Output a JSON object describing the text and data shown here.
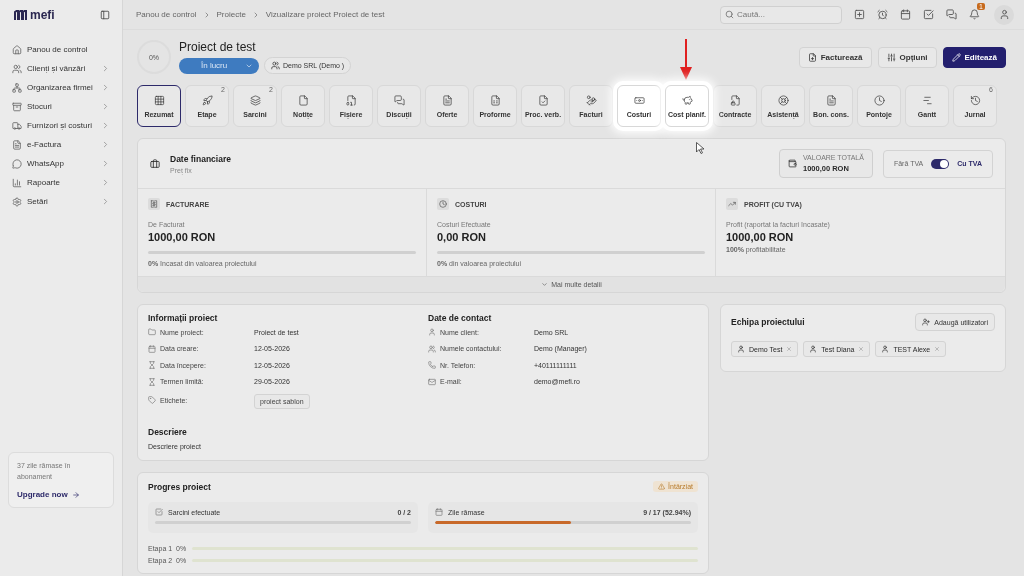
{
  "sidebar": {
    "logo": "mefi",
    "items": [
      {
        "label": "Panou de control",
        "has_children": false
      },
      {
        "label": "Clienți și vânzări",
        "has_children": true
      },
      {
        "label": "Organizarea firmei",
        "has_children": true
      },
      {
        "label": "Stocuri",
        "has_children": true
      },
      {
        "label": "Furnizori și costuri",
        "has_children": true
      },
      {
        "label": "e-Factura",
        "has_children": true
      },
      {
        "label": "WhatsApp",
        "has_children": true
      },
      {
        "label": "Rapoarte",
        "has_children": true
      },
      {
        "label": "Setări",
        "has_children": true
      }
    ],
    "upgrade": {
      "text": "37 zile rămase în abonament",
      "link": "Upgrade now"
    }
  },
  "header": {
    "breadcrumb": [
      "Panou de control",
      "Proiecte",
      "Vizualizare proiect Proiect de test"
    ],
    "search": {
      "placeholder": "Caută..."
    },
    "notification_count": "1"
  },
  "project": {
    "progress": "0%",
    "title": "Proiect de test",
    "status": "În lucru",
    "client": "Demo SRL (Demo )",
    "actions": [
      {
        "label": "Facturează",
        "kind": "outline"
      },
      {
        "label": "Opțiuni",
        "kind": "outline"
      },
      {
        "label": "Editează",
        "kind": "primary"
      }
    ]
  },
  "tabs": [
    {
      "label": "Rezumat",
      "selected": true,
      "highlighted": false
    },
    {
      "label": "Etape",
      "badge": "2",
      "selected": false,
      "highlighted": false
    },
    {
      "label": "Sarcini",
      "badge": "2",
      "selected": false,
      "highlighted": false
    },
    {
      "label": "Notițe",
      "selected": false,
      "highlighted": false
    },
    {
      "label": "Fișiere",
      "selected": false,
      "highlighted": false
    },
    {
      "label": "Discuții",
      "selected": false,
      "highlighted": false
    },
    {
      "label": "Oferte",
      "selected": false,
      "highlighted": false
    },
    {
      "label": "Proforme",
      "selected": false,
      "highlighted": false
    },
    {
      "label": "Proc. verb.",
      "selected": false,
      "highlighted": false
    },
    {
      "label": "Facturi",
      "selected": false,
      "highlighted": false
    },
    {
      "label": "Costuri",
      "selected": false,
      "highlighted": true
    },
    {
      "label": "Cost planif.",
      "selected": false,
      "highlighted": true
    },
    {
      "label": "Contracte",
      "selected": false,
      "highlighted": false
    },
    {
      "label": "Asistență",
      "selected": false,
      "highlighted": false
    },
    {
      "label": "Bon. cons.",
      "selected": false,
      "highlighted": false
    },
    {
      "label": "Pontoje",
      "selected": false,
      "highlighted": false
    },
    {
      "label": "Gantt",
      "selected": false,
      "highlighted": false
    },
    {
      "label": "Jurnal",
      "badge": "6",
      "selected": false,
      "highlighted": false
    }
  ],
  "financial": {
    "title": "Date financiare",
    "subtitle": "Preț fix",
    "total_label": "VALOARE TOTALĂ",
    "total": "1000,00 RON",
    "vat_off_label": "Fără TVA",
    "vat_on": true,
    "vat_on_label": "Cu TVA",
    "columns": [
      {
        "title": "FACTURARE",
        "label": "De Facturat",
        "value": "1000,00 RON",
        "has_bar": true,
        "level": 0,
        "note": "**0%** încasat din valoarea proiectului"
      },
      {
        "title": "COSTURI",
        "label": "Costuri Efectuate",
        "value": "0,00 RON",
        "has_bar": true,
        "level": 0,
        "note": "**0%** din valoarea proiectului"
      },
      {
        "title": "PROFIT (CU TVA)",
        "label": "Profit (raportat la facturi încasate)",
        "value": "1000,00 RON",
        "has_bar": false,
        "note": "**100%** profitabilitate"
      }
    ],
    "more": "Mai multe detalii"
  },
  "info": {
    "title": "Informații proiect",
    "rows": [
      {
        "label": "Nume proiect:",
        "value": "Proiect de test"
      },
      {
        "label": "Data creare:",
        "value": "12-05-2026"
      },
      {
        "label": "Data începere:",
        "value": "12-05-2026"
      },
      {
        "label": "Termen limită:",
        "value": "29-05-2026"
      },
      {
        "label": "Etichete:",
        "value": "proiect sablon",
        "kind": "tag"
      }
    ],
    "contact_title": "Date de contact",
    "contact_rows": [
      {
        "label": "Nume client:",
        "value": "Demo SRL"
      },
      {
        "label": "Numele contactului:",
        "value": "Demo (Manager)"
      },
      {
        "label": "Nr. Telefon:",
        "value": "+40111111111"
      },
      {
        "label": "E-mail:",
        "value": "demo@mefi.ro"
      }
    ],
    "description_title": "Descriere",
    "description": "Descriere proiect"
  },
  "team": {
    "title": "Echipa proiectului",
    "add": "Adaugă utilizatori",
    "members": [
      "Demo Test",
      "Test Diana",
      "TEST Alexe"
    ]
  },
  "progress": {
    "title": "Progres proiect",
    "badge": "Întârziat",
    "stats": [
      {
        "label": "Sarcini efectuate",
        "value": "0 / 2",
        "level": 0
      },
      {
        "label": "Zile rămase",
        "value": "9 / 17 (52.94%)",
        "level": 0.5294
      }
    ],
    "stages": [
      {
        "label": "Etapa 1",
        "value": "0%",
        "level": 0
      },
      {
        "label": "Etapa 2",
        "value": "0%",
        "level": 0
      }
    ]
  }
}
